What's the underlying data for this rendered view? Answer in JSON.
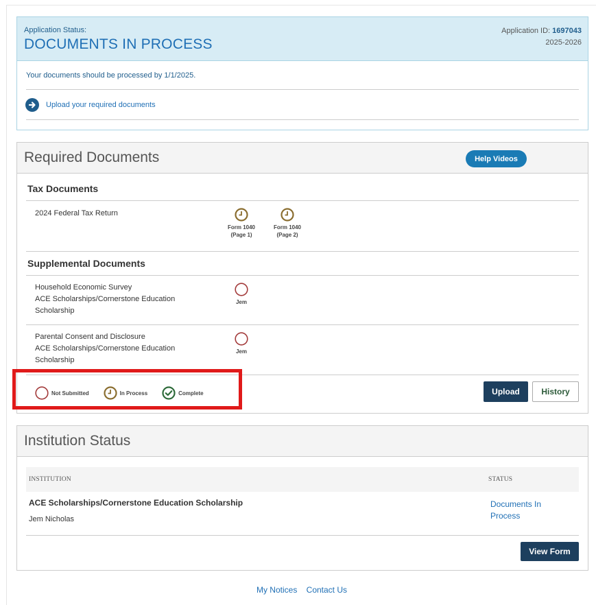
{
  "status": {
    "label": "Application Status:",
    "title": "DOCUMENTS IN PROCESS",
    "app_id_label": "Application ID:",
    "app_id": "1697043",
    "year": "2025-2026",
    "message": "Your documents should be processed by 1/1/2025.",
    "upload_link": "Upload your required documents"
  },
  "required": {
    "title": "Required Documents",
    "help_button": "Help Videos",
    "tax_section": "Tax Documents",
    "tax_doc": "2024 Federal Tax Return",
    "tax_forms": [
      {
        "line1": "Form 1040",
        "line2": "(Page 1)",
        "state": "in-process"
      },
      {
        "line1": "Form 1040",
        "line2": "(Page 2)",
        "state": "in-process"
      }
    ],
    "supp_section": "Supplemental Documents",
    "supp_docs": [
      {
        "name": "Household Economic Survey",
        "org": "ACE Scholarships/Cornerstone Education Scholarship",
        "person": "Jem",
        "state": "not-submitted"
      },
      {
        "name": "Parental Consent and Disclosure",
        "org": "ACE Scholarships/Cornerstone Education Scholarship",
        "person": "Jem",
        "state": "not-submitted"
      }
    ],
    "legend": {
      "not_submitted": "Not Submitted",
      "in_process": "In Process",
      "complete": "Complete"
    },
    "upload_button": "Upload",
    "history_button": "History"
  },
  "institution": {
    "title": "Institution Status",
    "col_institution": "INSTITUTION",
    "col_status": "STATUS",
    "name": "ACE Scholarships/Cornerstone Education Scholarship",
    "person": "Jem Nicholas",
    "status_line1": "Documents In",
    "status_line2": "Process",
    "view_button": "View Form"
  },
  "footer": {
    "notices": "My Notices",
    "contact": "Contact Us"
  },
  "colors": {
    "not_submitted": "#a33b3b",
    "in_process": "#8a6d2f",
    "complete": "#2e6b3a",
    "highlight": "#e01a1a"
  }
}
